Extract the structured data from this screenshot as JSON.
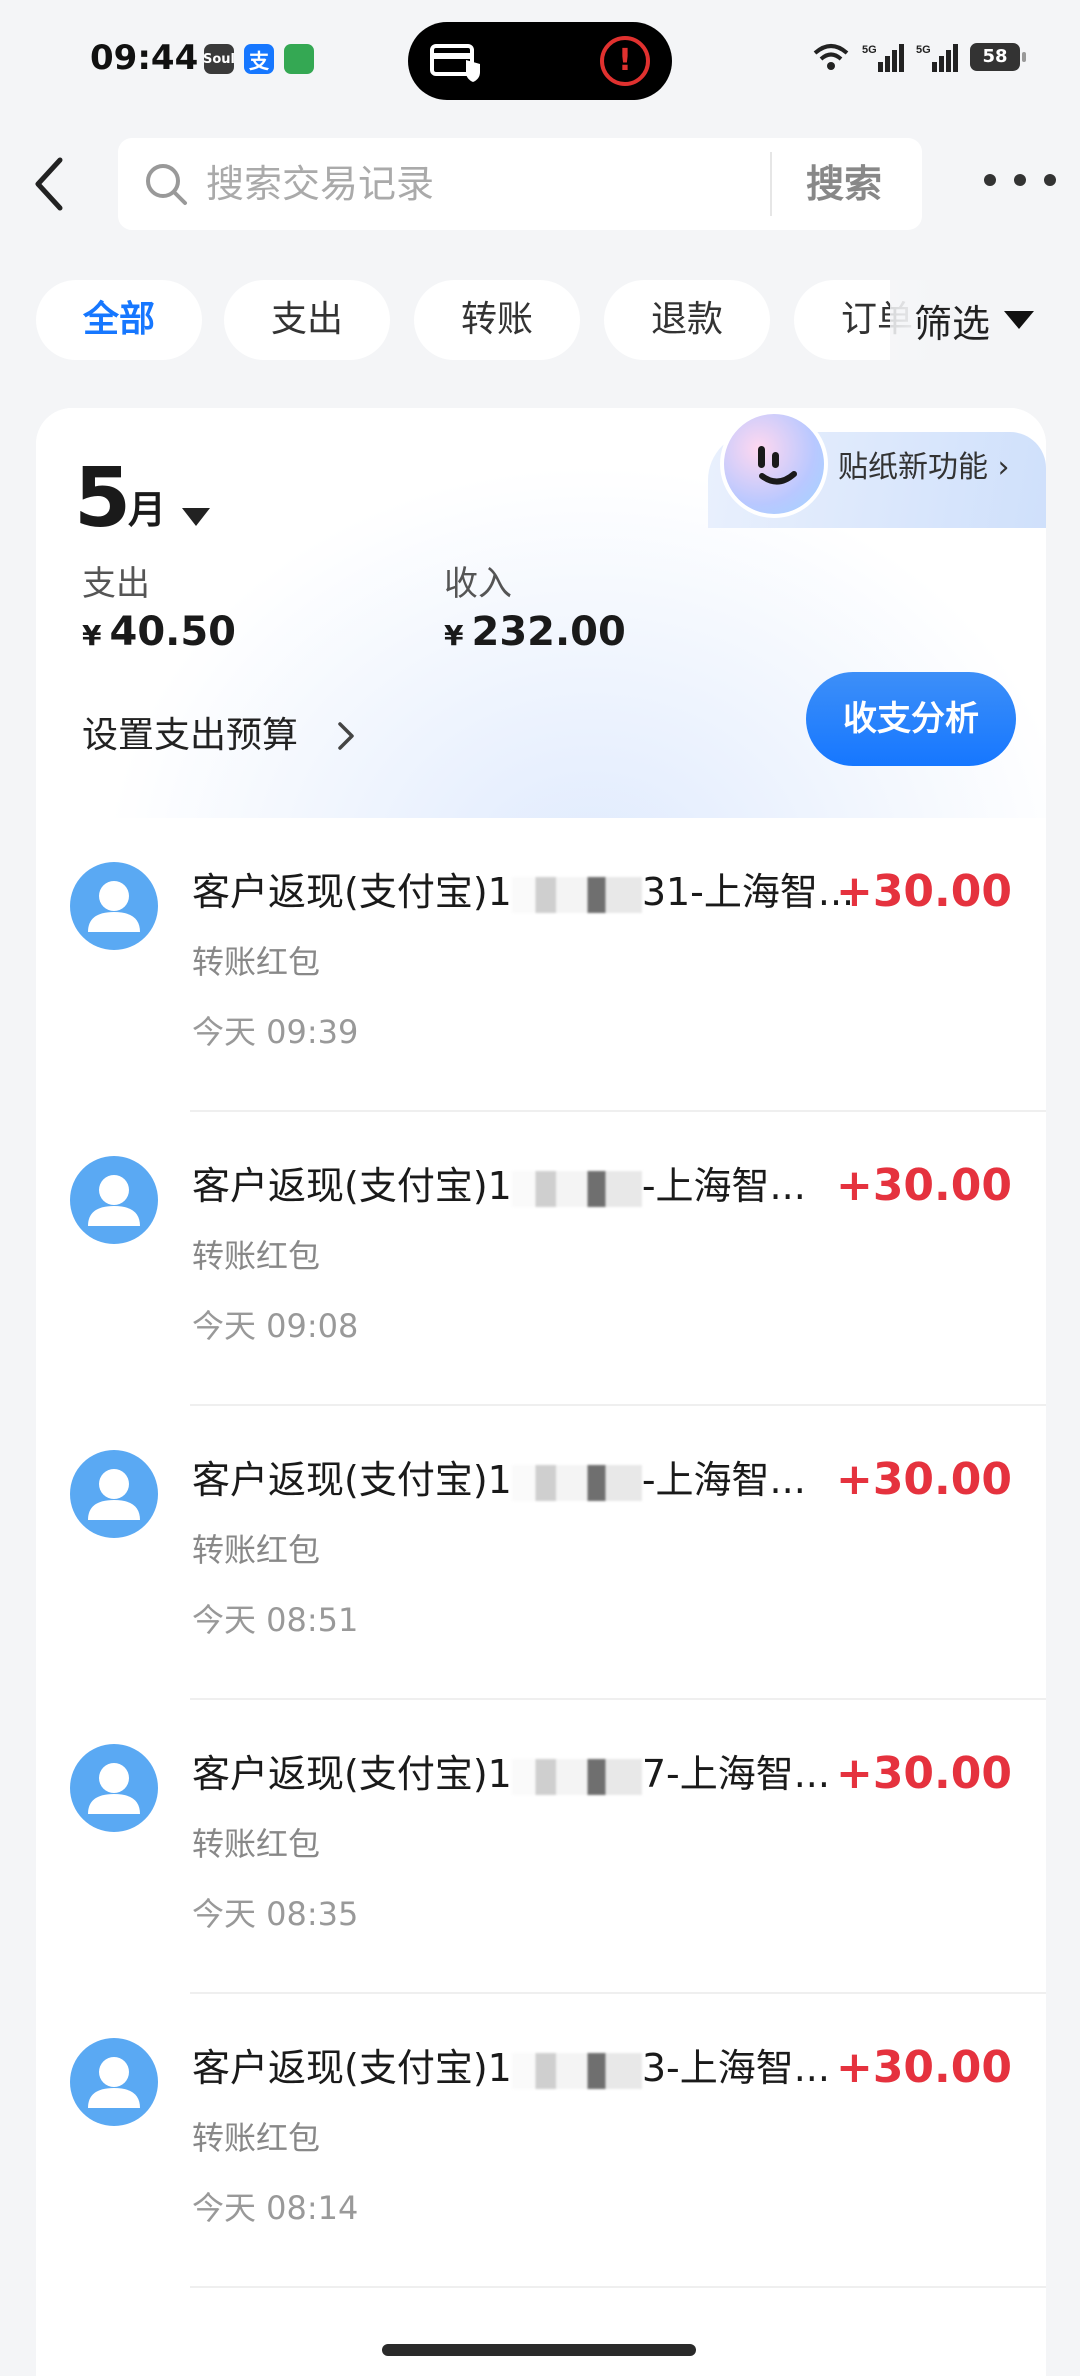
{
  "status_bar": {
    "time": "09:44",
    "app_icons": [
      "Soul",
      "支",
      "app-icon"
    ],
    "battery": "58",
    "signal_labels": [
      "5G",
      "5G"
    ]
  },
  "header": {
    "search_placeholder": "搜索交易记录",
    "search_button": "搜索"
  },
  "filters": {
    "chips": [
      "全部",
      "支出",
      "转账",
      "退款",
      "订单"
    ],
    "active_chip": "全部",
    "filter_label": "筛选"
  },
  "summary": {
    "month_num": "5",
    "month_unit": "月",
    "sticker_text": "贴纸新功能",
    "expense_label": "支出",
    "expense_value": "40.50",
    "income_label": "收入",
    "income_value": "232.00",
    "currency": "¥",
    "budget_link": "设置支出预算",
    "analysis_button": "收支分析"
  },
  "transactions": [
    {
      "title_prefix": "客户返现(支付宝)1",
      "title_suffix": "31-上海智...",
      "type": "转账红包",
      "time": "今天 09:39",
      "amount": "+30.00"
    },
    {
      "title_prefix": "客户返现(支付宝)1",
      "title_suffix": "-上海智...",
      "type": "转账红包",
      "time": "今天 09:08",
      "amount": "+30.00"
    },
    {
      "title_prefix": "客户返现(支付宝)1",
      "title_suffix": "-上海智...",
      "type": "转账红包",
      "time": "今天 08:51",
      "amount": "+30.00"
    },
    {
      "title_prefix": "客户返现(支付宝)1",
      "title_suffix": "7-上海智...",
      "type": "转账红包",
      "time": "今天 08:35",
      "amount": "+30.00"
    },
    {
      "title_prefix": "客户返现(支付宝)1",
      "title_suffix": "3-上海智...",
      "type": "转账红包",
      "time": "今天 08:14",
      "amount": "+30.00"
    }
  ],
  "colors": {
    "accent": "#1677ff",
    "income_amount": "#e5323e",
    "avatar": "#5aa9f3"
  }
}
